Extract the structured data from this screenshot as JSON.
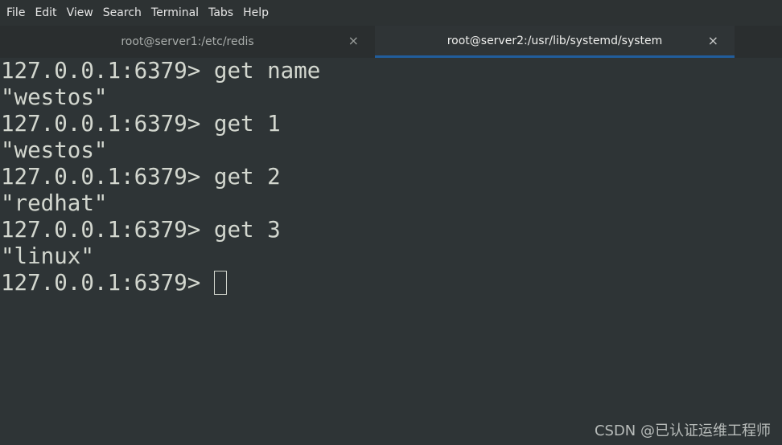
{
  "menubar": {
    "items": [
      "File",
      "Edit",
      "View",
      "Search",
      "Terminal",
      "Tabs",
      "Help"
    ]
  },
  "tabs": [
    {
      "title": "root@server1:/etc/redis",
      "close": "×",
      "active": false
    },
    {
      "title": "root@server2:/usr/lib/systemd/system",
      "close": "×",
      "active": true
    }
  ],
  "terminal": {
    "lines": [
      "127.0.0.1:6379> get name",
      "\"westos\"",
      "127.0.0.1:6379> get 1",
      "\"westos\"",
      "127.0.0.1:6379> get 2",
      "\"redhat\"",
      "127.0.0.1:6379> get 3",
      "\"linux\""
    ],
    "prompt": "127.0.0.1:6379> "
  },
  "watermark": "CSDN @已认证运维工程师",
  "colors": {
    "background": "#2e3436",
    "text": "#d3d7cf",
    "active_tab_indicator": "#215d9c"
  }
}
